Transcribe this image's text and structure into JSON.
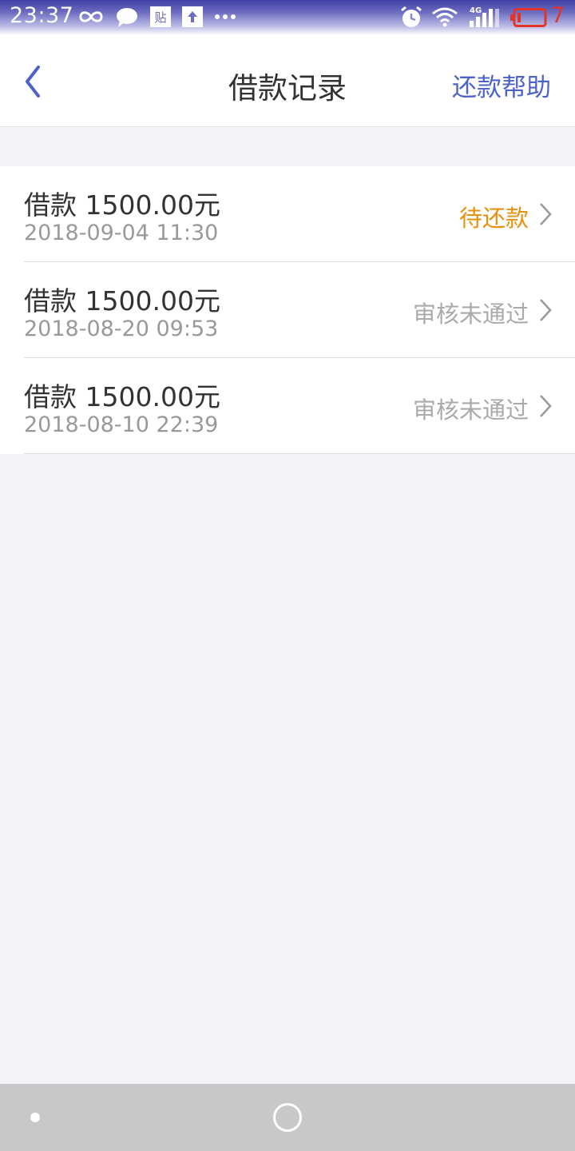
{
  "status_bar": {
    "time": "23:37",
    "icons": [
      "infinity-icon",
      "chat-bubble-icon",
      "tieba-icon",
      "upload-icon",
      "more-dots-icon",
      "alarm-icon",
      "wifi-icon",
      "signal-icon",
      "battery-icon"
    ],
    "network_label": "4G",
    "battery_level": "7",
    "battery_color": "#e3342a"
  },
  "header": {
    "title": "借款记录",
    "help_label": "还款帮助",
    "back_icon": "chevron-left-icon",
    "accent_color": "#4d63c8"
  },
  "loans": [
    {
      "amount": "借款 1500.00元",
      "date": "2018-09-04 11:30",
      "status": "待还款",
      "status_color": "#e8910f"
    },
    {
      "amount": "借款 1500.00元",
      "date": "2018-08-20 09:53",
      "status": "审核未通过",
      "status_color": "#aaaaaa"
    },
    {
      "amount": "借款 1500.00元",
      "date": "2018-08-10 22:39",
      "status": "审核未通过",
      "status_color": "#aaaaaa"
    }
  ],
  "nav_bar": {
    "icons": [
      "nav-dot-icon",
      "home-circle-icon"
    ]
  }
}
